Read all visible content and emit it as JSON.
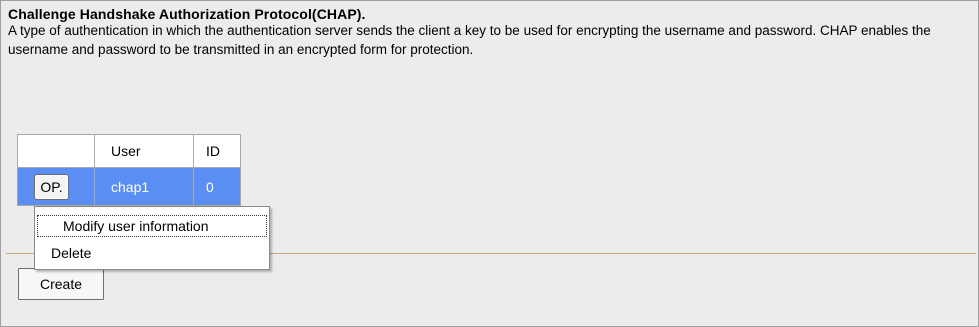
{
  "header": {
    "title": "Challenge Handshake Authorization Protocol(CHAP).",
    "description": "A type of authentication in which the authentication server sends the client a key to be used for encrypting the username and password. CHAP enables the username and password to be transmitted in an encrypted form for protection."
  },
  "table": {
    "columns": [
      "",
      "User",
      "ID"
    ],
    "rows": [
      {
        "op_label": "OP.",
        "user": "chap1",
        "id": "0"
      }
    ]
  },
  "context_menu": {
    "items": [
      "Modify user information",
      "Delete"
    ]
  },
  "actions": {
    "create_label": "Create"
  },
  "colors": {
    "selected_row": "#5b8ef2",
    "panel_background": "#ececec",
    "divider": "#c9a97e"
  }
}
